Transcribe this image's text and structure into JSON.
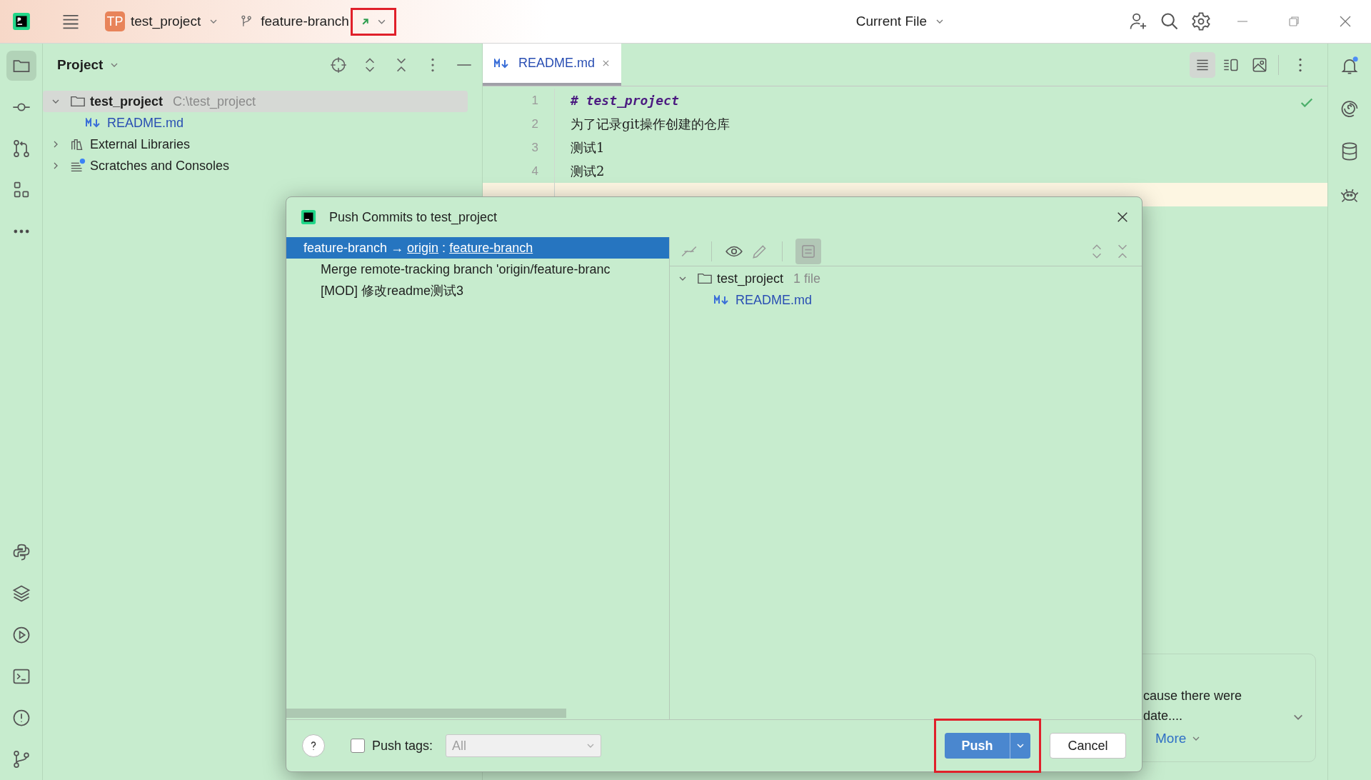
{
  "titlebar": {
    "project_badge": "TP",
    "project": "test_project",
    "branch": "feature-branch",
    "run_config": "Current File"
  },
  "project_panel": {
    "title": "Project",
    "tree": [
      {
        "label": "test_project",
        "path": "C:\\test_project",
        "kind": "folder",
        "expanded": true,
        "selected": true,
        "children": [
          {
            "label": "README.md",
            "kind": "markdown",
            "selected": false
          }
        ]
      },
      {
        "label": "External Libraries",
        "kind": "library",
        "expanded": false,
        "selected": false
      },
      {
        "label": "Scratches and Consoles",
        "kind": "scratches",
        "expanded": false,
        "selected": false
      }
    ]
  },
  "editor": {
    "tabs": [
      {
        "label": "README.md",
        "selected": true
      }
    ],
    "lines": [
      {
        "number": "1",
        "text": "# test_project",
        "kind": "heading",
        "current": false
      },
      {
        "number": "2",
        "text": "为了记录git操作创建的仓库",
        "kind": "text",
        "current": false
      },
      {
        "number": "3",
        "text": "测试1",
        "kind": "text",
        "current": false
      },
      {
        "number": "4",
        "text": "测试2",
        "kind": "text",
        "current": false
      },
      {
        "current": true
      }
    ]
  },
  "notification": {
    "lines": [
      "cause there were",
      "date...."
    ],
    "link": "More"
  },
  "dialog": {
    "title": "Push Commits to test_project",
    "push_spec": {
      "source": "feature-branch",
      "arrow": "→",
      "remote": "origin",
      "separator": ":",
      "target": "feature-branch",
      "selected": true
    },
    "commits": [
      "Merge remote-tracking branch 'origin/feature-branc",
      "[MOD] 修改readme测试3"
    ],
    "changes": {
      "folder": "test_project",
      "count": "1 file",
      "files": [
        "README.md"
      ]
    },
    "push_tags": {
      "label": "Push tags:",
      "checked": false,
      "value": "All"
    },
    "buttons": {
      "push": "Push",
      "cancel": "Cancel"
    }
  }
}
